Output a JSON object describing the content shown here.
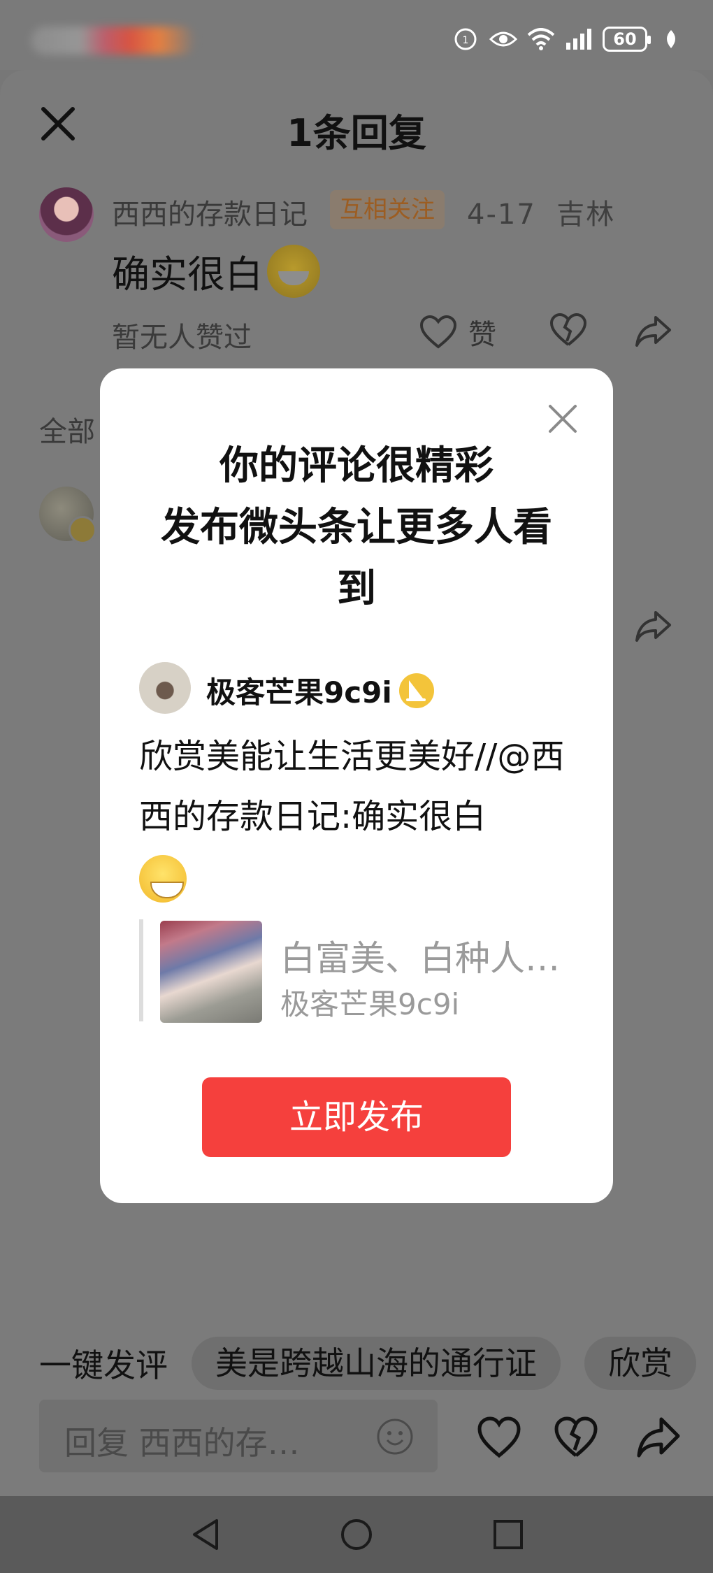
{
  "status_bar": {
    "battery": "60"
  },
  "header": {
    "title": "1条回复"
  },
  "comment": {
    "username": "西西的存款日记",
    "badge": "互相关注",
    "date": "4-17",
    "location": "吉林",
    "text": "确实很白",
    "likes_text": "暂无人赞过",
    "like_label": "赞"
  },
  "section": {
    "label": "全部"
  },
  "modal": {
    "title_line1": "你的评论很精彩",
    "title_line2": "发布微头条让更多人看",
    "title_line3": "到",
    "username": "极客芒果9c9i",
    "text": "欣赏美能让生活更美好//@西西的存款日记:确实很白",
    "quote_title": "白富美、白种人…",
    "quote_author": "极客芒果9c9i",
    "button": "立即发布"
  },
  "bottom": {
    "chips_label": "一键发评",
    "chips": [
      "美是跨越山海的通行证",
      "欣赏"
    ],
    "reply_placeholder": "回复 西西的存…"
  },
  "colors": {
    "publish_button": "#f5403d",
    "badge_text": "#9c5d22",
    "sail_badge": "#f3c43a"
  }
}
